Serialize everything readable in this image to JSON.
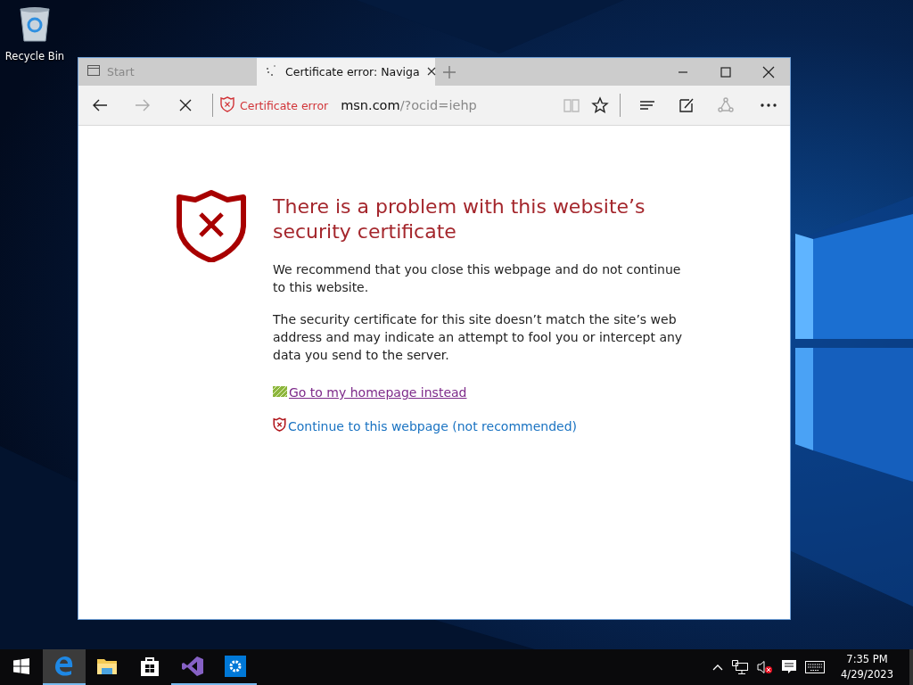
{
  "desktop": {
    "icons": [
      {
        "label": "Recycle Bin"
      }
    ]
  },
  "browser": {
    "tabs": [
      {
        "label": "Start",
        "selected": false
      },
      {
        "label": "Certificate error: Naviga",
        "selected": true
      }
    ],
    "address": {
      "security_label": "Certificate error",
      "host": "msn.com",
      "path": "/?ocid=iehp"
    },
    "page": {
      "heading": "There is a problem with this website’s security certificate",
      "paragraphs": [
        "We recommend that you close this webpage and do not continue to this website.",
        "The security certificate for this site doesn’t match the site’s web address and may indicate an attempt to fool you or intercept any data you send to the server."
      ],
      "links": [
        {
          "kind": "home",
          "label": "Go to my homepage instead",
          "visited": true
        },
        {
          "kind": "continue",
          "label": "Continue to this webpage (not recommended)",
          "visited": false
        }
      ]
    }
  },
  "taskbar": {
    "apps": [
      {
        "kind": "edge",
        "selected": true,
        "running": true
      },
      {
        "kind": "explorer",
        "selected": false,
        "running": false
      },
      {
        "kind": "store",
        "selected": false,
        "running": false
      },
      {
        "kind": "vs",
        "selected": false,
        "running": true
      },
      {
        "kind": "settings",
        "selected": false,
        "running": true
      }
    ],
    "clock": {
      "time": "7:35 PM",
      "date": "4/29/2023"
    }
  }
}
